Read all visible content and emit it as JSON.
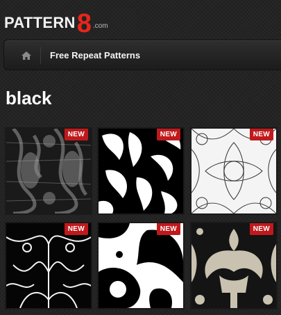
{
  "logo": {
    "word": "PATTERN",
    "number": "8",
    "domain": ".com"
  },
  "nav": {
    "home_icon": "home-icon",
    "link_label": "Free Repeat Patterns"
  },
  "page": {
    "title": "black"
  },
  "badge_label": "NEW",
  "colors": {
    "accent": "#e8261b",
    "badge": "#c0191c"
  },
  "tiles": [
    {
      "style": "grunge-damask"
    },
    {
      "style": "paisley-leaves"
    },
    {
      "style": "kaleidoscope-lines"
    },
    {
      "style": "baroque-lines"
    },
    {
      "style": "bold-swirls"
    },
    {
      "style": "beige-damask"
    }
  ]
}
